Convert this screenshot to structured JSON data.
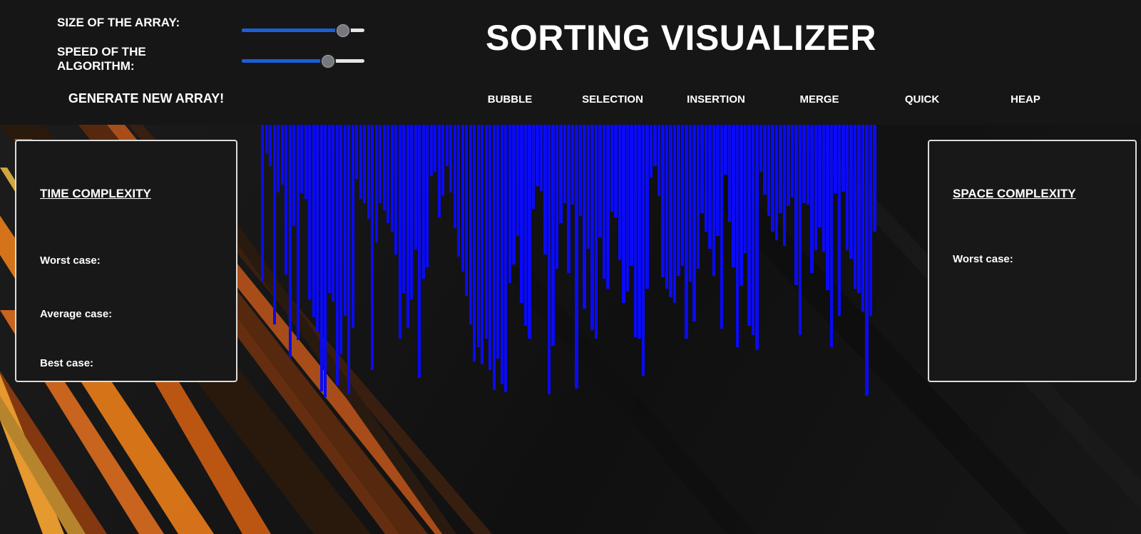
{
  "header": {
    "title": "SORTING VISUALIZER",
    "size_label": "SIZE OF THE ARRAY:",
    "speed_label": "SPEED OF THE ALGORITHM:",
    "size_value": 0.82,
    "speed_value": 0.7,
    "generate_label": "GENERATE NEW ARRAY!",
    "algorithms": [
      "BUBBLE",
      "SELECTION",
      "INSERTION",
      "MERGE",
      "QUICK",
      "HEAP"
    ]
  },
  "time_panel": {
    "title": "TIME COMPLEXITY",
    "worst_label": "Worst case:",
    "average_label": "Average case:",
    "best_label": "Best case:"
  },
  "space_panel": {
    "title": "SPACE COMPLEXITY",
    "worst_label": "Worst case:"
  },
  "colors": {
    "bar": "#0a0af5",
    "header_bg": "#161616",
    "slider_fill": "#1a5fd6",
    "panel_border": "#dcdcdc"
  },
  "array": {
    "values": [
      220,
      40,
      58,
      280,
      95,
      84,
      210,
      326,
      142,
      302,
      96,
      104,
      245,
      270,
      290,
      374,
      382,
      236,
      248,
      365,
      322,
      268,
      378,
      285,
      76,
      104,
      110,
      132,
      344,
      165,
      110,
      120,
      138,
      150,
      182,
      300,
      236,
      285,
      245,
      175,
      355,
      216,
      200,
      72,
      66,
      130,
      99,
      58,
      95,
      145,
      185,
      206,
      240,
      280,
      332,
      312,
      336,
      300,
      344,
      372,
      328,
      364,
      375,
      222,
      196,
      156,
      250,
      282,
      300,
      118,
      86,
      93,
      182,
      378,
      310,
      202,
      138,
      110,
      208,
      112,
      370,
      128,
      258,
      174,
      288,
      300,
      158,
      216,
      230,
      122,
      130,
      190,
      250,
      234,
      198,
      298,
      300,
      352,
      230,
      74,
      58,
      100,
      214,
      230,
      242,
      250,
      212,
      198,
      300,
      220,
      276,
      202,
      124,
      150,
      174,
      212,
      156,
      286,
      70,
      136,
      200,
      312,
      226,
      180,
      282,
      295,
      316,
      66,
      98,
      128,
      150,
      162,
      124,
      170,
      114,
      102,
      225,
      295,
      110,
      112,
      208,
      176,
      144,
      178,
      232,
      312,
      96,
      268,
      94,
      176,
      188,
      230,
      236,
      262,
      380,
      268,
      150
    ]
  }
}
